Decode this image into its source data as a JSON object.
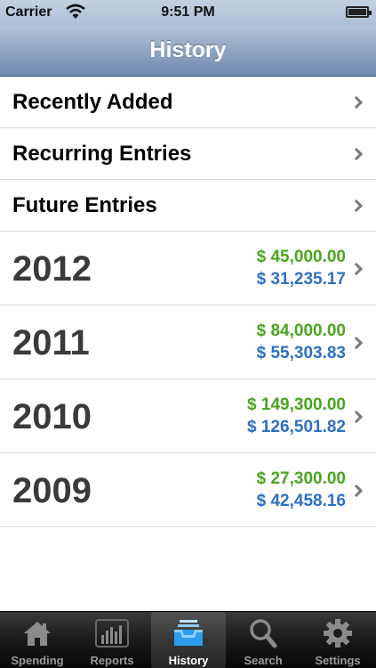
{
  "status_bar": {
    "carrier": "Carrier",
    "time": "9:51 PM"
  },
  "nav": {
    "title": "History"
  },
  "links": [
    {
      "label": "Recently Added"
    },
    {
      "label": "Recurring Entries"
    },
    {
      "label": "Future Entries"
    }
  ],
  "years": [
    {
      "year": "2012",
      "income": "$ 45,000.00",
      "expense": "$ 31,235.17"
    },
    {
      "year": "2011",
      "income": "$ 84,000.00",
      "expense": "$ 55,303.83"
    },
    {
      "year": "2010",
      "income": "$ 149,300.00",
      "expense": "$ 126,501.82"
    },
    {
      "year": "2009",
      "income": "$ 27,300.00",
      "expense": "$ 42,458.16"
    }
  ],
  "tabs": [
    {
      "label": "Spending",
      "icon": "house-icon"
    },
    {
      "label": "Reports",
      "icon": "bar-chart-icon"
    },
    {
      "label": "History",
      "icon": "inbox-tray-icon",
      "active": true
    },
    {
      "label": "Search",
      "icon": "magnifier-icon"
    },
    {
      "label": "Settings",
      "icon": "gear-icon"
    }
  ],
  "colors": {
    "income": "#4aa51f",
    "expense": "#2f6fc4",
    "nav_bar": "#8ea5c2",
    "tab_bar": "#1a1a1a"
  }
}
